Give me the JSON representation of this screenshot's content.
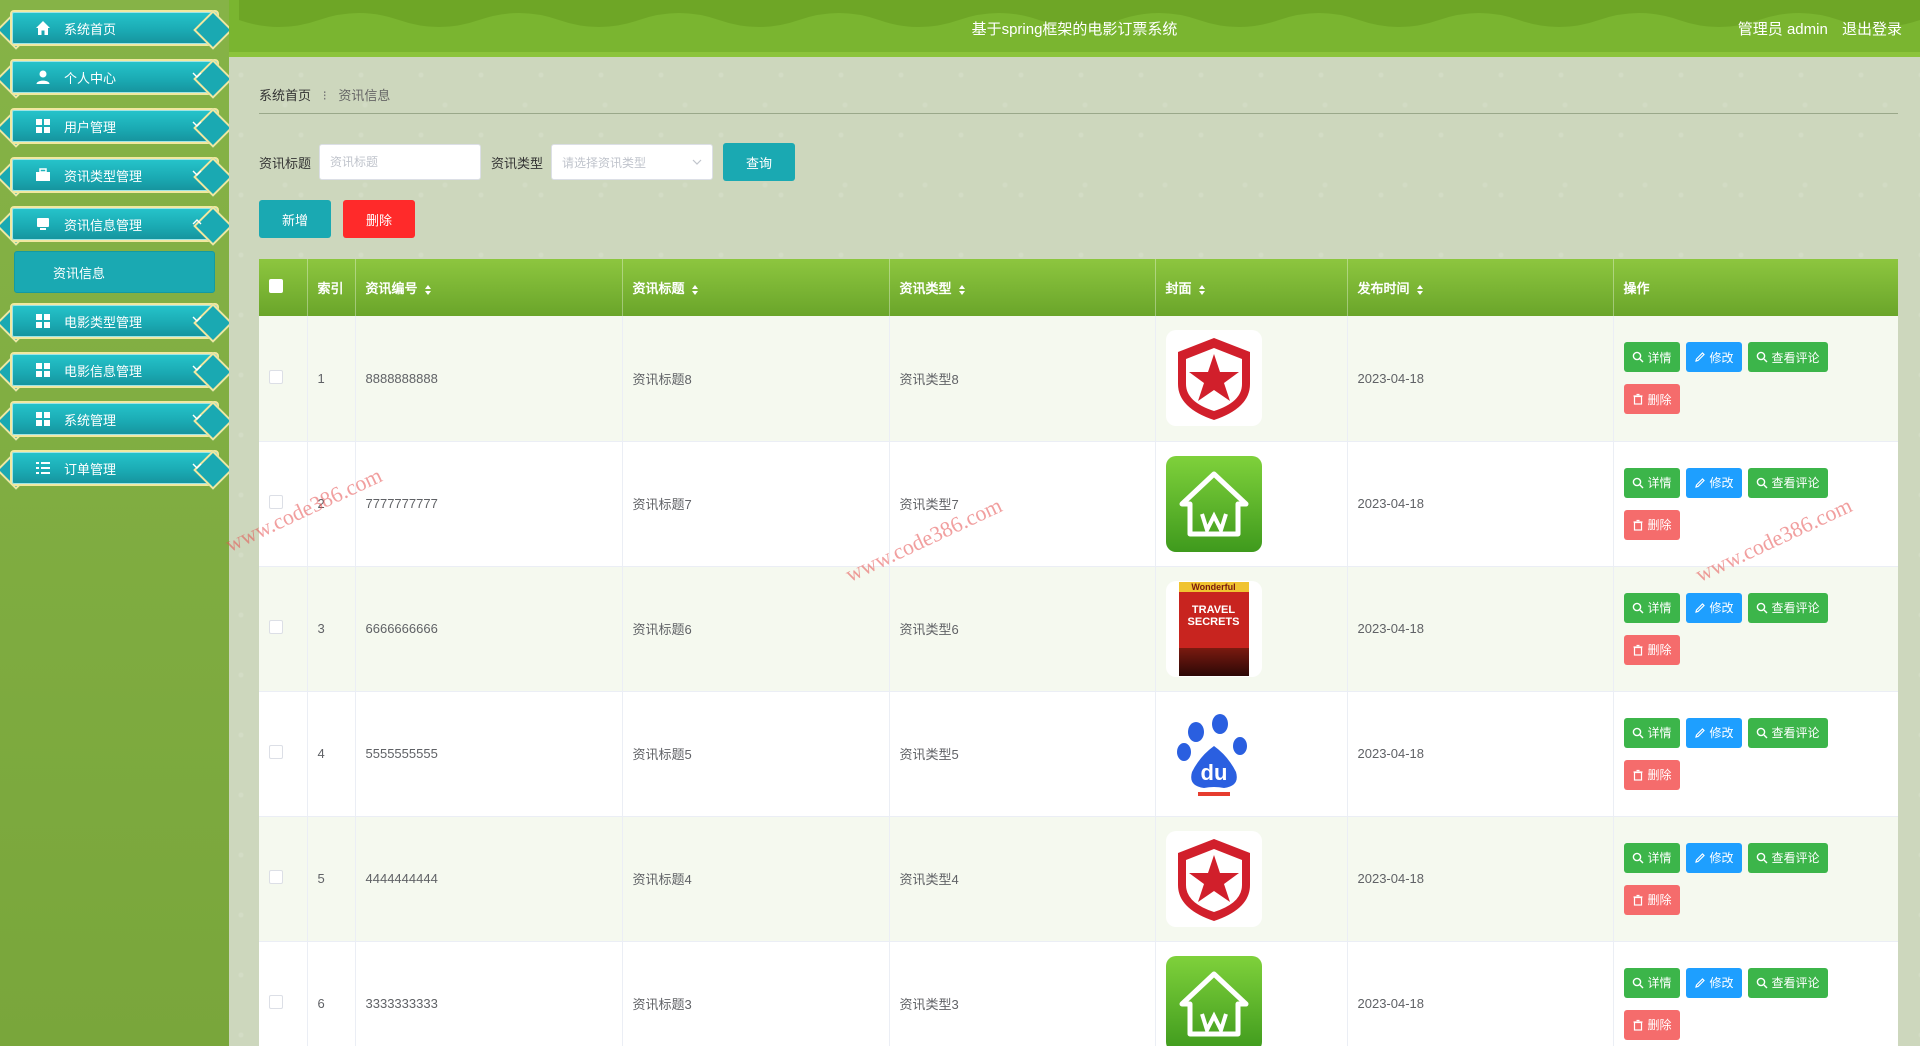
{
  "header": {
    "title": "基于spring框架的电影订票系统",
    "user_label": "管理员 admin",
    "logout_label": "退出登录"
  },
  "sidebar": {
    "items": [
      {
        "label": "系统首页",
        "icon": "home-icon"
      },
      {
        "label": "个人中心",
        "icon": "user-icon"
      },
      {
        "label": "用户管理",
        "icon": "grid-icon"
      },
      {
        "label": "资讯类型管理",
        "icon": "briefcase-icon"
      },
      {
        "label": "资讯信息管理",
        "icon": "monitor-icon"
      },
      {
        "label": "电影类型管理",
        "icon": "grid-icon"
      },
      {
        "label": "电影信息管理",
        "icon": "grid-icon"
      },
      {
        "label": "系统管理",
        "icon": "grid-icon"
      },
      {
        "label": "订单管理",
        "icon": "list-icon"
      }
    ],
    "submenu": {
      "label": "资讯信息"
    }
  },
  "breadcrumb": {
    "home": "系统首页",
    "current": "资讯信息"
  },
  "search": {
    "title_label": "资讯标题",
    "title_placeholder": "资讯标题",
    "type_label": "资讯类型",
    "type_placeholder": "请选择资讯类型",
    "query_label": "查询"
  },
  "actions": {
    "add_label": "新增",
    "delete_label": "删除"
  },
  "table": {
    "columns": [
      "索引",
      "资讯编号",
      "资讯标题",
      "资讯类型",
      "封面",
      "发布时间",
      "操作"
    ],
    "op_labels": {
      "detail": "详情",
      "edit": "修改",
      "comments": "查看评论",
      "remove": "删除"
    },
    "rows": [
      {
        "index": "1",
        "number": "8888888888",
        "title": "资讯标题8",
        "type": "资讯类型8",
        "cover": "red-star-logo",
        "time": "2023-04-18"
      },
      {
        "index": "2",
        "number": "7777777777",
        "title": "资讯标题7",
        "type": "资讯类型7",
        "cover": "green-house-logo",
        "time": "2023-04-18"
      },
      {
        "index": "3",
        "number": "6666666666",
        "title": "资讯标题6",
        "type": "资讯类型6",
        "cover": "travel-book-cover",
        "time": "2023-04-18"
      },
      {
        "index": "4",
        "number": "5555555555",
        "title": "资讯标题5",
        "type": "资讯类型5",
        "cover": "baidu-logo",
        "time": "2023-04-18"
      },
      {
        "index": "5",
        "number": "4444444444",
        "title": "资讯标题4",
        "type": "资讯类型4",
        "cover": "red-star-logo",
        "time": "2023-04-18"
      },
      {
        "index": "6",
        "number": "3333333333",
        "title": "资讯标题3",
        "type": "资讯类型3",
        "cover": "green-house-logo",
        "time": "2023-04-18"
      }
    ]
  },
  "covers": {
    "travel_book": {
      "brand": "Wonderful",
      "line1": "TRAVEL",
      "line2": "SECRETS"
    },
    "baidu": {
      "text": "du"
    }
  },
  "watermark": "www.code386.com",
  "colors": {
    "teal": "#1aa9b2",
    "header_green": "#7ab530",
    "danger_red": "#ff2a2a",
    "success_green": "#3cb54a",
    "edit_blue": "#1e9fff"
  }
}
